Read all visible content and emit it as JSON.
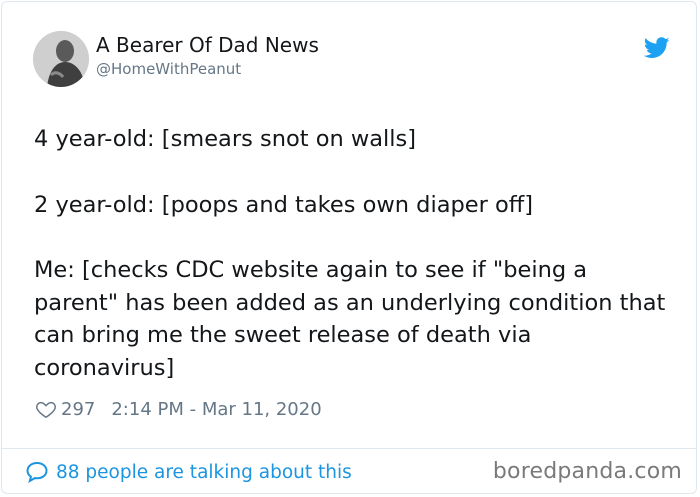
{
  "author": {
    "name": "A Bearer Of Dad News",
    "handle": "@HomeWithPeanut",
    "avatar_icon": "profile-photo"
  },
  "platform_icon": "twitter-bird-icon",
  "brand_color": "#1da1f2",
  "tweet": {
    "paragraphs": [
      "4 year-old: [smears snot on walls]",
      "2 year-old: [poops and takes own diaper off]",
      "Me: [checks CDC website again to see if \"being a parent\" has been added as an underlying condition that can bring me the sweet release of death via coronavirus]"
    ]
  },
  "meta": {
    "likes": "297",
    "timestamp": "2:14 PM - Mar 11, 2020"
  },
  "footer": {
    "talking": "88 people are talking about this",
    "link_color": "#1b95e0"
  },
  "watermark": "boredpanda.com"
}
